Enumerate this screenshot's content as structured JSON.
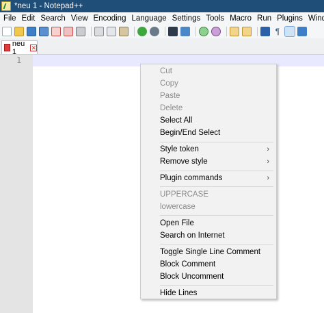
{
  "window": {
    "title": "*neu 1 - Notepad++"
  },
  "menu": [
    "File",
    "Edit",
    "Search",
    "View",
    "Encoding",
    "Language",
    "Settings",
    "Tools",
    "Macro",
    "Run",
    "Plugins",
    "Window"
  ],
  "toolbar": {
    "icons": [
      "new-file-icon",
      "open-file-icon",
      "save-icon",
      "save-all-icon",
      "close-icon",
      "close-all-icon",
      "print-icon",
      "cut-icon",
      "copy-icon",
      "paste-icon",
      "undo-icon",
      "redo-icon",
      "find-icon",
      "replace-icon",
      "zoom-in-icon",
      "zoom-out-icon",
      "sync-vertical-icon",
      "sync-horizontal-icon",
      "word-wrap-icon",
      "show-all-characters-icon",
      "indent-guide-icon",
      "user-defined-language-icon"
    ]
  },
  "tab": {
    "label": "neu 1",
    "close_glyph": "✕"
  },
  "editor": {
    "line_number": "1"
  },
  "context_menu": {
    "items": [
      {
        "label": "Cut",
        "disabled": true
      },
      {
        "label": "Copy",
        "disabled": true
      },
      {
        "label": "Paste",
        "disabled": true
      },
      {
        "label": "Delete",
        "disabled": true
      },
      {
        "label": "Select All",
        "disabled": false
      },
      {
        "label": "Begin/End Select",
        "disabled": false
      },
      {
        "label": "Style token",
        "disabled": false,
        "submenu": true
      },
      {
        "label": "Remove style",
        "disabled": false,
        "submenu": true
      },
      {
        "label": "Plugin commands",
        "disabled": false,
        "submenu": true
      },
      {
        "label": "UPPERCASE",
        "disabled": true
      },
      {
        "label": "lowercase",
        "disabled": true
      },
      {
        "label": "Open File",
        "disabled": false
      },
      {
        "label": "Search on Internet",
        "disabled": false
      },
      {
        "label": "Toggle Single Line Comment",
        "disabled": false
      },
      {
        "label": "Block Comment",
        "disabled": false
      },
      {
        "label": "Block Uncomment",
        "disabled": false
      },
      {
        "label": "Hide Lines",
        "disabled": false
      }
    ],
    "submenu_glyph": "›"
  }
}
